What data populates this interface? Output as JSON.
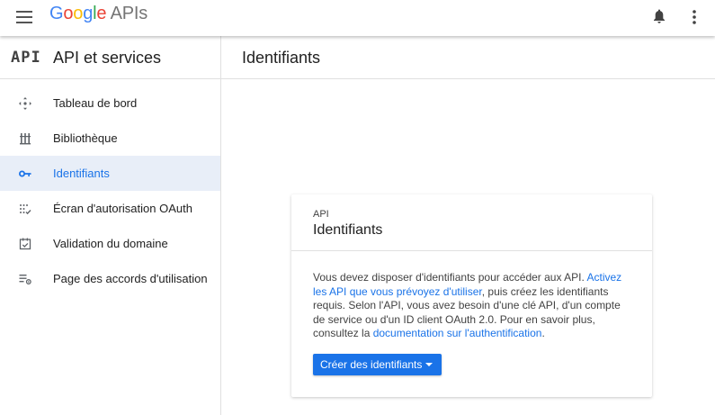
{
  "header": {
    "logo_google": [
      "G",
      "o",
      "o",
      "g",
      "l",
      "e"
    ],
    "logo_suffix": "APIs"
  },
  "sidebar": {
    "badge": "API",
    "title": "API et services",
    "items": [
      {
        "label": "Tableau de bord",
        "icon": "dashboard-icon",
        "active": false
      },
      {
        "label": "Bibliothèque",
        "icon": "library-icon",
        "active": false
      },
      {
        "label": "Identifiants",
        "icon": "key-icon",
        "active": true
      },
      {
        "label": "Écran d'autorisation OAuth",
        "icon": "oauth-consent-icon",
        "active": false
      },
      {
        "label": "Validation du domaine",
        "icon": "domain-check-icon",
        "active": false
      },
      {
        "label": "Page des accords d'utilisation",
        "icon": "agreements-icon",
        "active": false
      }
    ]
  },
  "main": {
    "title": "Identifiants",
    "card": {
      "kicker": "API",
      "title": "Identifiants",
      "body_1": "Vous devez disposer d'identifiants pour accéder aux API. ",
      "link_1": "Activez les API que vous prévoyez d'utiliser",
      "body_2": ", puis créez les identifiants requis. Selon l'API, vous avez besoin d'une clé API, d'un compte de service ou d'un ID client OAuth 2.0. Pour en savoir plus, consultez la ",
      "link_2": "documentation sur l'authentification",
      "body_3": ".",
      "button_label": "Créer des identifiants"
    }
  },
  "colors": {
    "accent": "#1a73e8",
    "active_bg": "#e8eef8",
    "divider": "#e0e0e0"
  }
}
